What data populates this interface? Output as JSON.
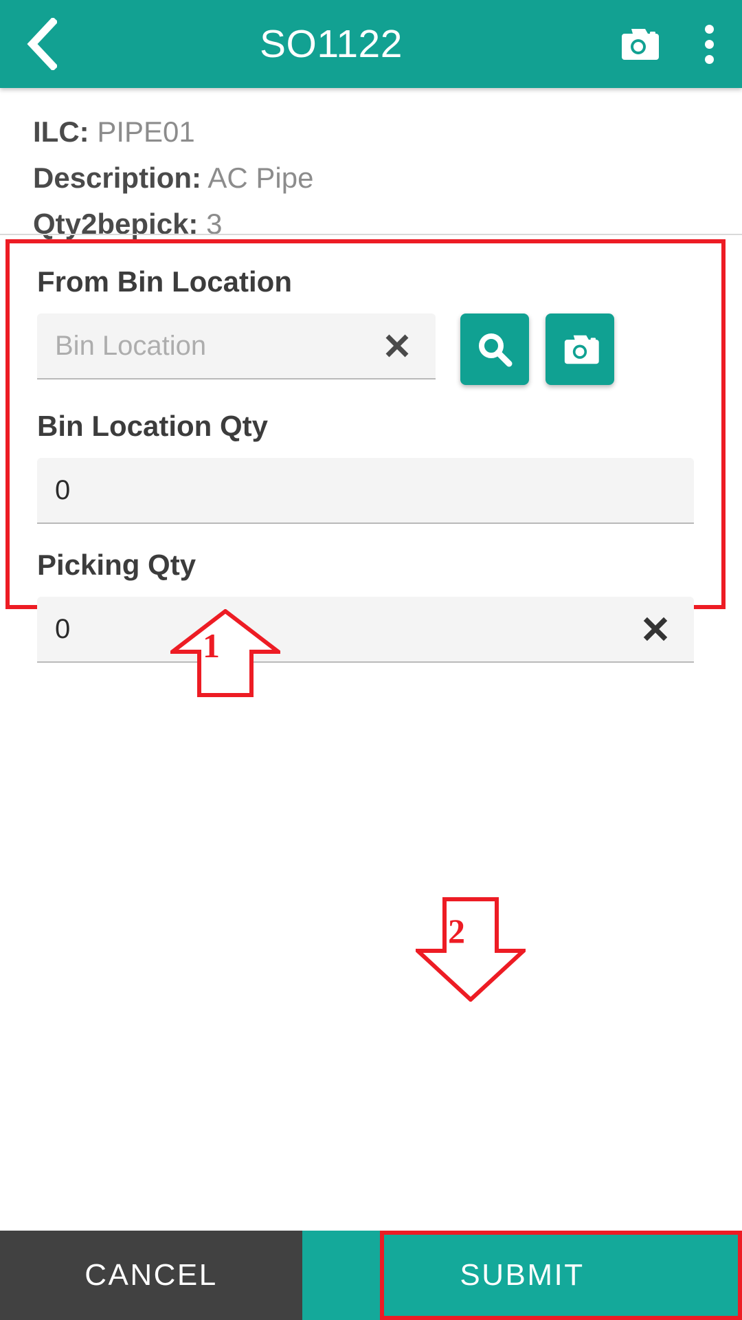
{
  "header": {
    "title": "SO1122",
    "back_icon": "back-chevron-icon",
    "camera_icon": "camera-icon",
    "menu_icon": "overflow-menu-icon",
    "background_color": "#12a192"
  },
  "info": {
    "ilc_label": "ILC:",
    "ilc_value": "PIPE01",
    "description_label": "Description:",
    "description_value": "AC Pipe",
    "qty_label": "Qty2bepick:",
    "qty_value": "3"
  },
  "form": {
    "from_bin_location": {
      "label": "From Bin Location",
      "value": "",
      "placeholder": "Bin Location",
      "clear_icon": "clear-x-icon",
      "search_icon": "search-icon",
      "camera_icon": "camera-icon"
    },
    "bin_location_qty": {
      "label": "Bin Location Qty",
      "value": "0"
    },
    "picking_qty": {
      "label": "Picking Qty",
      "value": "0",
      "clear_icon": "clear-x-icon"
    }
  },
  "annotations": {
    "marker_1": "1",
    "marker_2": "2",
    "color": "#ed1c24"
  },
  "footer": {
    "cancel_label": "CANCEL",
    "submit_label": "SUBMIT",
    "cancel_color": "#414141",
    "submit_color": "#14a99a"
  }
}
